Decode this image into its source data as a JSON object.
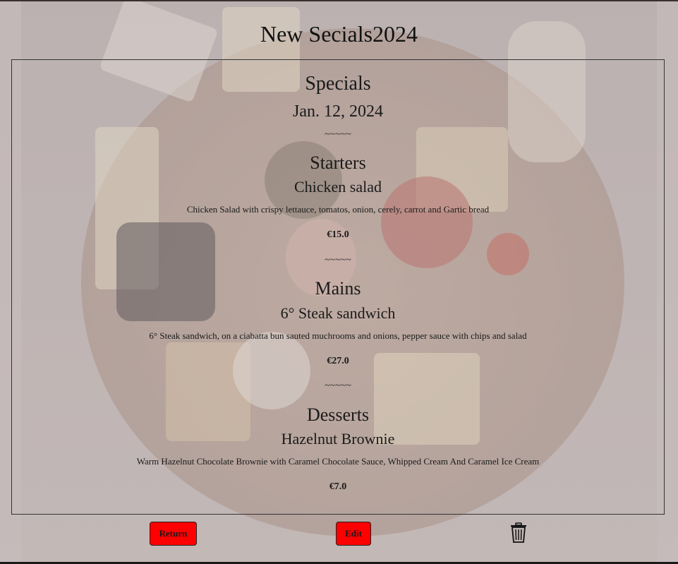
{
  "page": {
    "title": "New Secials2024"
  },
  "menu": {
    "heading": "Specials",
    "date": "Jan. 12, 2024",
    "divider": "~~~~~",
    "sections": [
      {
        "name": "Starters",
        "item": {
          "name": "Chicken salad",
          "description": "Chicken Salad with crispy lettauce, tomatos, onion, cerely, carrot and Gartic bread",
          "price": "€15.0"
        }
      },
      {
        "name": "Mains",
        "item": {
          "name": "6° Steak sandwich",
          "description": "6° Steak sandwich, on a ciabatta bun sauted muchrooms and onions, pepper sauce with chips and salad",
          "price": "€27.0"
        }
      },
      {
        "name": "Desserts",
        "item": {
          "name": "Hazelnut Brownie",
          "description": "Warm Hazelnut Chocolate Brownie with Caramel Chocolate Sauce, Whipped Cream And Caramel Ice Cream",
          "price": "€7.0"
        }
      }
    ]
  },
  "actions": {
    "return_label": "Return",
    "edit_label": "Edit",
    "delete_icon": "trash-icon",
    "button_color": "#ff0000"
  }
}
